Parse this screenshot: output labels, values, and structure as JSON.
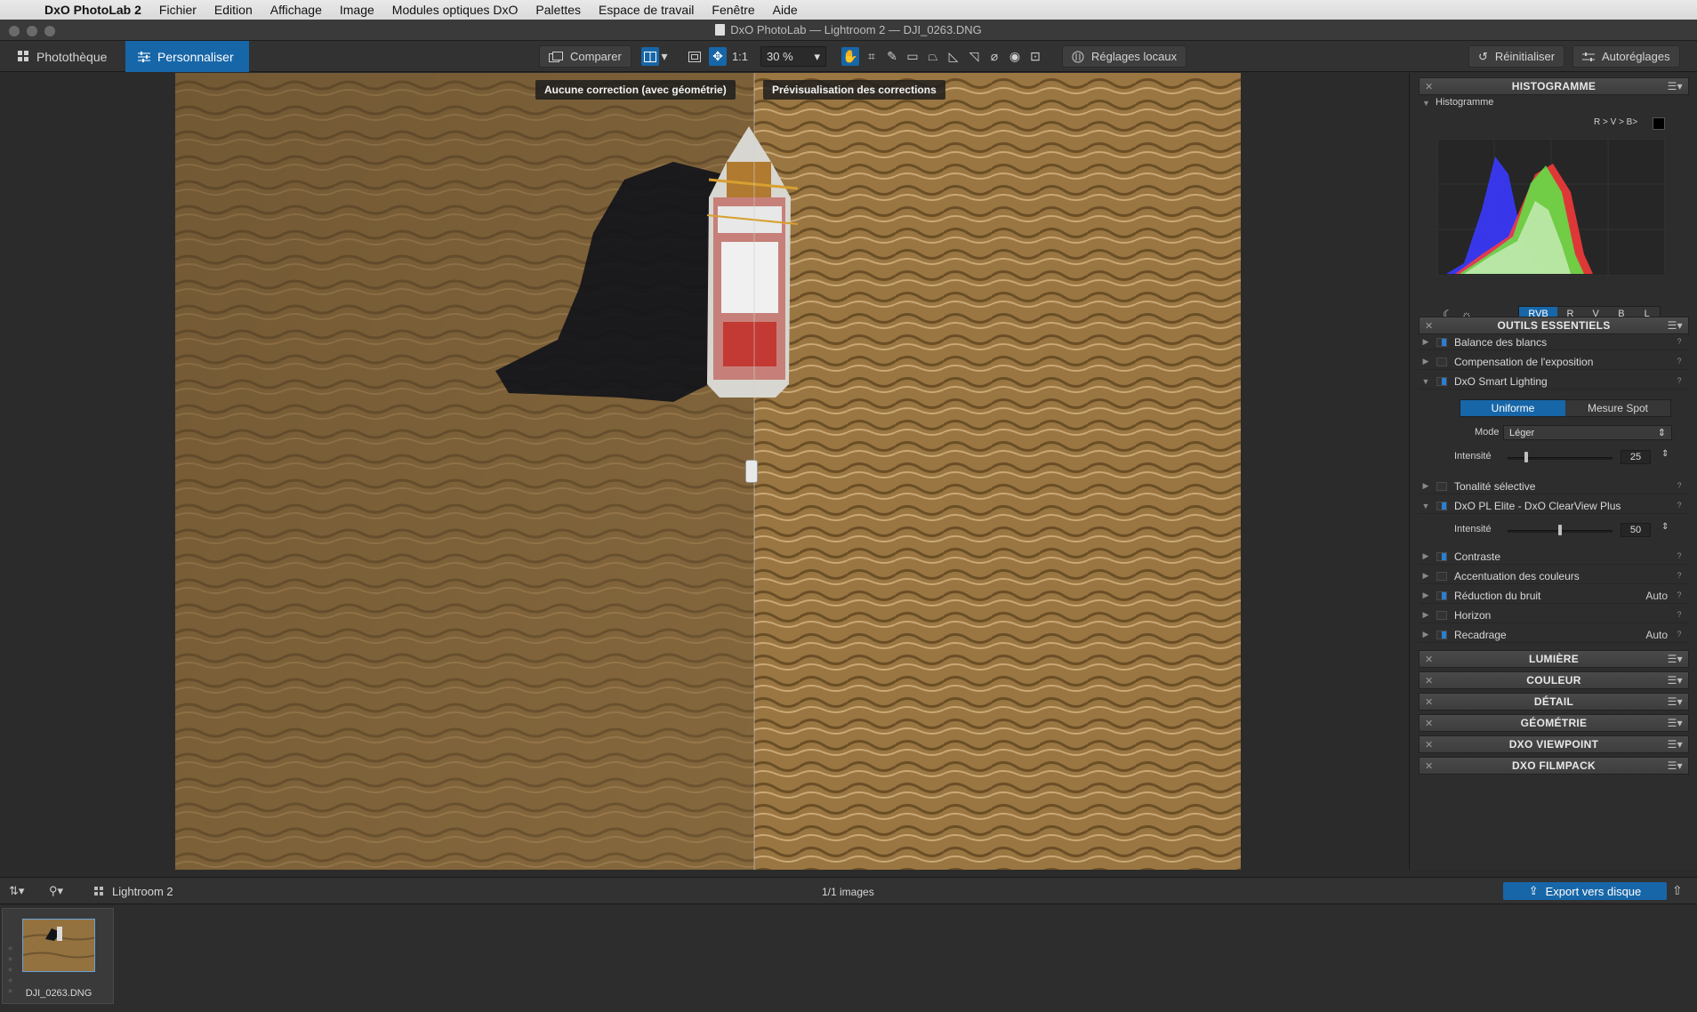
{
  "menubar": {
    "app_name": "DxO PhotoLab 2",
    "items": [
      "Fichier",
      "Edition",
      "Affichage",
      "Image",
      "Modules optiques DxO",
      "Palettes",
      "Espace de travail",
      "Fenêtre",
      "Aide"
    ]
  },
  "window": {
    "title": "DxO PhotoLab — Lightroom 2 — DJI_0263.DNG"
  },
  "toolbar": {
    "tab_library": "Photothèque",
    "tab_customize": "Personnaliser",
    "compare_label": "Comparer",
    "ratio_label": "1:1",
    "zoom_value": "30 %",
    "local_adjust_label": "Réglages locaux",
    "reset_label": "Réinitialiser",
    "auto_label": "Autoréglages"
  },
  "viewer": {
    "left_label": "Aucune correction (avec géométrie)",
    "right_label": "Prévisualisation des corrections"
  },
  "histogram": {
    "palette_title": "HISTOGRAMME",
    "section_label": "Histogramme",
    "readout": "R > V > B>",
    "channels": [
      "RVB",
      "R",
      "V",
      "B",
      "L"
    ],
    "active_channel": "RVB"
  },
  "essentials": {
    "palette_title": "OUTILS ESSENTIELS",
    "tools": [
      {
        "label": "Balance des blancs",
        "expanded": false,
        "on": true,
        "auto": ""
      },
      {
        "label": "Compensation de l'exposition",
        "expanded": false,
        "on": false,
        "auto": ""
      },
      {
        "label": "DxO Smart Lighting",
        "expanded": true,
        "on": true,
        "auto": ""
      },
      {
        "label": "Tonalité sélective",
        "expanded": false,
        "on": false,
        "auto": ""
      },
      {
        "label": "DxO PL Elite - DxO ClearView Plus",
        "expanded": true,
        "on": true,
        "auto": ""
      },
      {
        "label": "Contraste",
        "expanded": false,
        "on": true,
        "auto": ""
      },
      {
        "label": "Accentuation des couleurs",
        "expanded": false,
        "on": false,
        "auto": ""
      },
      {
        "label": "Réduction du bruit",
        "expanded": false,
        "on": true,
        "auto": "Auto"
      },
      {
        "label": "Horizon",
        "expanded": false,
        "on": false,
        "auto": ""
      },
      {
        "label": "Recadrage",
        "expanded": false,
        "on": true,
        "auto": "Auto"
      }
    ],
    "smart_lighting": {
      "mode_uniform": "Uniforme",
      "mode_spot": "Mesure Spot",
      "mode_label": "Mode",
      "mode_value": "Léger",
      "intensity_label": "Intensité",
      "intensity_value": "25"
    },
    "clearview": {
      "intensity_label": "Intensité",
      "intensity_value": "50"
    }
  },
  "collapsed_palettes": [
    "LUMIÈRE",
    "COULEUR",
    "DÉTAIL",
    "GÉOMÉTRIE",
    "DXO VIEWPOINT",
    "DXO FILMPACK"
  ],
  "bottombar": {
    "folder_name": "Lightroom 2",
    "image_count": "1/1 images",
    "export_label": "Export vers disque"
  },
  "filmstrip": {
    "items": [
      {
        "name": "DJI_0263.DNG"
      }
    ]
  },
  "colors": {
    "accent": "#1766a8",
    "panel": "#2d2d2d",
    "water_left": "#8a6a3c",
    "water_right": "#9c7640"
  }
}
